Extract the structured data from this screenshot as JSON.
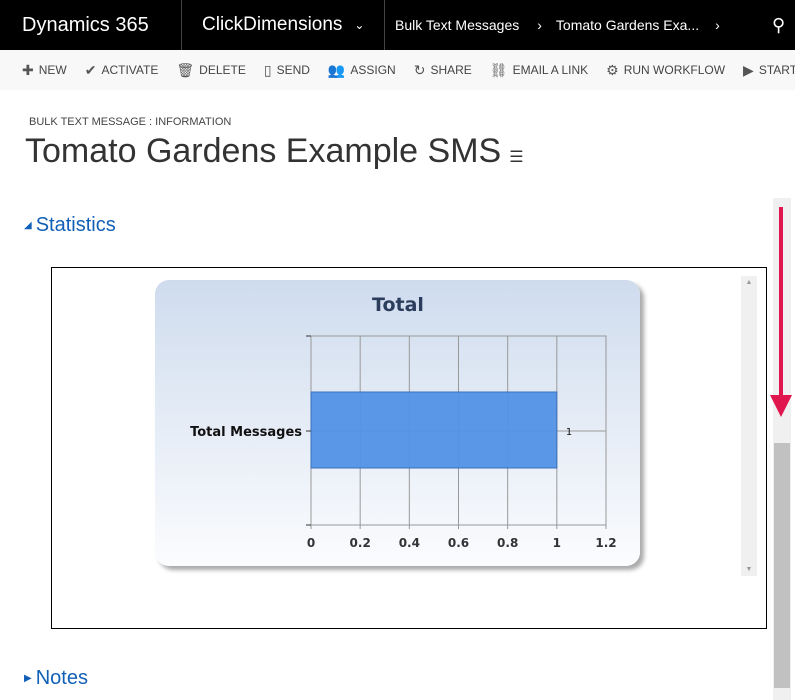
{
  "topbar": {
    "app": "Dynamics 365",
    "module": "ClickDimensions",
    "breadcrumb": [
      "Bulk Text Messages",
      "Tomato Gardens Exa..."
    ]
  },
  "commands": [
    {
      "icon": "plus-icon",
      "glyph": "✚",
      "label": "NEW"
    },
    {
      "icon": "check-icon",
      "glyph": "✔",
      "label": "ACTIVATE"
    },
    {
      "icon": "trash-icon",
      "glyph": "🗑",
      "label": "DELETE"
    },
    {
      "icon": "phone-icon",
      "glyph": "▯",
      "label": "SEND"
    },
    {
      "icon": "assign-icon",
      "glyph": "👥",
      "label": "ASSIGN"
    },
    {
      "icon": "share-icon",
      "glyph": "↻",
      "label": "SHARE"
    },
    {
      "icon": "link-icon",
      "glyph": "⛓",
      "label": "EMAIL A LINK"
    },
    {
      "icon": "workflow-icon",
      "glyph": "⚙",
      "label": "RUN WORKFLOW"
    },
    {
      "icon": "dialog-icon",
      "glyph": "▶",
      "label": "START DIALOG"
    }
  ],
  "form": {
    "entity_label": "BULK TEXT MESSAGE : INFORMATION",
    "title": "Tomato Gardens Example SMS"
  },
  "sections": {
    "statistics": "Statistics",
    "notes": "Notes"
  },
  "chart_data": {
    "type": "bar",
    "orientation": "horizontal",
    "title": "Total",
    "categories": [
      "Total Messages"
    ],
    "values": [
      1
    ],
    "data_labels": [
      "1"
    ],
    "xlim": [
      0,
      1.2
    ],
    "xticks": [
      "0",
      "0.2",
      "0.4",
      "0.6",
      "0.8",
      "1",
      "1.2"
    ],
    "grid": true,
    "bar_color": "#5292e6"
  },
  "colors": {
    "accent": "#1160b7",
    "annotation_arrow": "#e0174f"
  }
}
